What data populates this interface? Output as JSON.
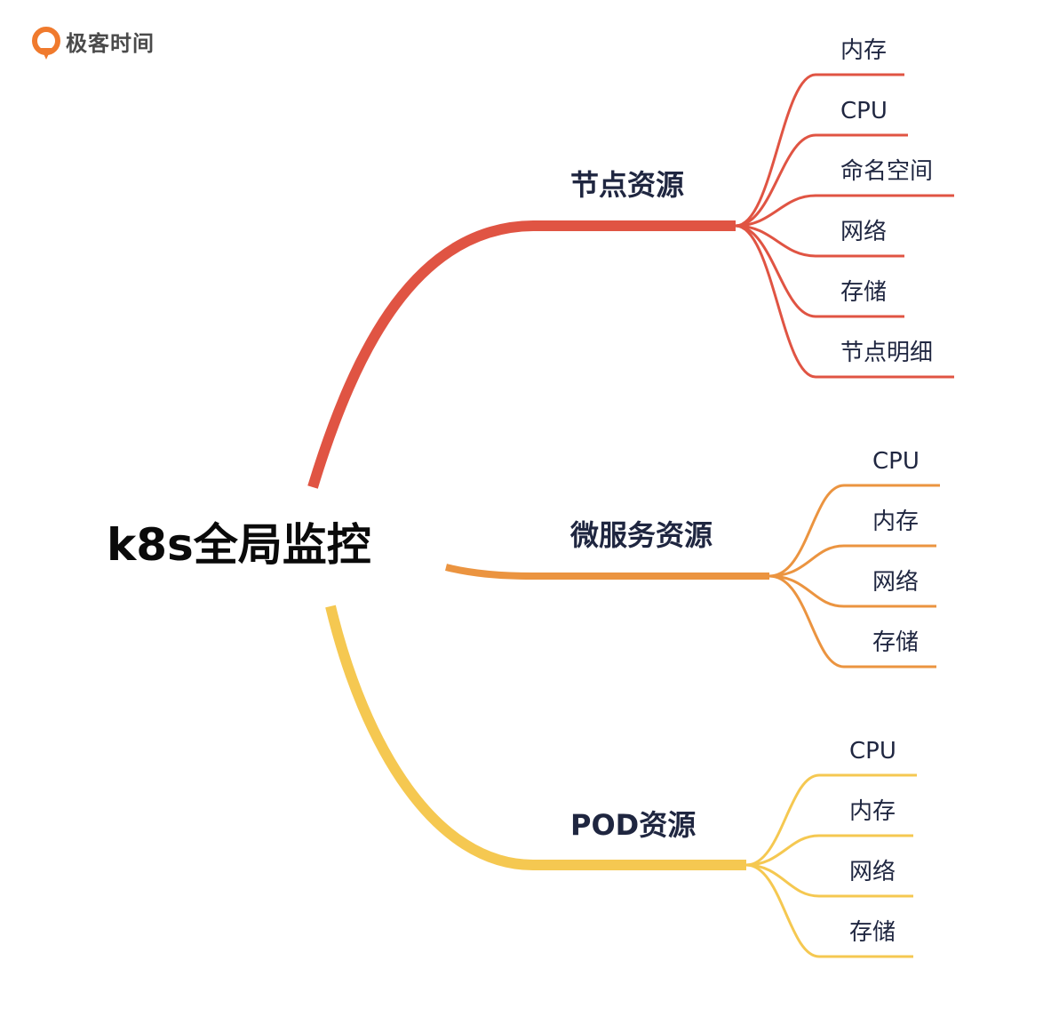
{
  "logo": {
    "text": "极客时间",
    "brand_color": "#f07a2d"
  },
  "root": {
    "label": "k8s全局监控"
  },
  "branches": [
    {
      "label": "节点资源",
      "color": "#e05443",
      "leaves": [
        "内存",
        "CPU",
        "命名空间",
        "网络",
        "存储",
        "节点明细"
      ]
    },
    {
      "label": "微服务资源",
      "color": "#eb9440",
      "leaves": [
        "CPU",
        "内存",
        "网络",
        "存储"
      ]
    },
    {
      "label": "POD资源",
      "color": "#f5c851",
      "leaves": [
        "CPU",
        "内存",
        "网络",
        "存储"
      ]
    }
  ]
}
